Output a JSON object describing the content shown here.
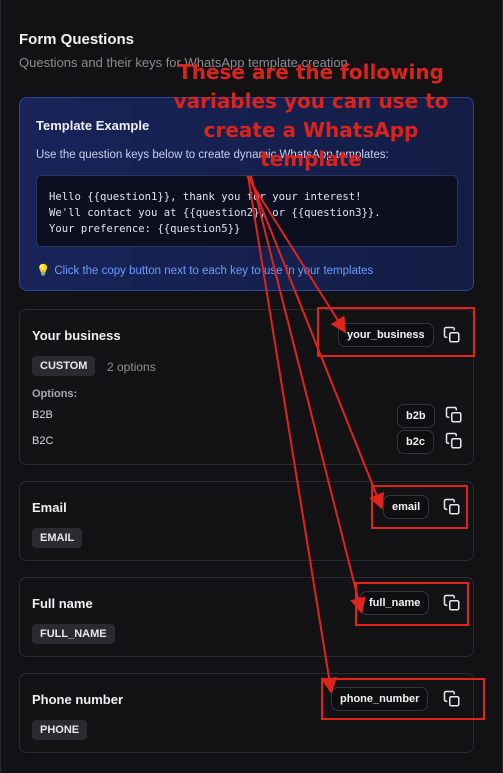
{
  "header": {
    "title": "Form Questions",
    "subtitle": "Questions and their keys for WhatsApp template creation"
  },
  "template_example": {
    "title": "Template Example",
    "description": "Use the question keys below to create dynamic WhatsApp templates:",
    "code_lines": [
      "Hello {{question1}}, thank you for your interest!",
      "We'll contact you at {{question2}} or {{question3}}.",
      "Your preference: {{question5}}"
    ],
    "tip": "Click the copy button next to each key to use in your templates",
    "tip_icon": "lightbulb-icon"
  },
  "questions": [
    {
      "label": "Your business",
      "type": "CUSTOM",
      "option_count": "2 options",
      "key": "your_business",
      "options_heading": "Options:",
      "options": [
        {
          "label": "B2B",
          "key": "b2b"
        },
        {
          "label": "B2C",
          "key": "b2c"
        }
      ]
    },
    {
      "label": "Email",
      "type": "EMAIL",
      "key": "email"
    },
    {
      "label": "Full name",
      "type": "FULL_NAME",
      "key": "full_name"
    },
    {
      "label": "Phone number",
      "type": "PHONE",
      "key": "phone_number"
    }
  ],
  "annotation": {
    "text": "These are the following variables you can use to create a WhatsApp template",
    "color": "#d9231b"
  },
  "colors": {
    "accent_blue": "#6f9bff",
    "highlight_red": "#e0241b"
  },
  "icons": {
    "copy": "copy-icon"
  }
}
